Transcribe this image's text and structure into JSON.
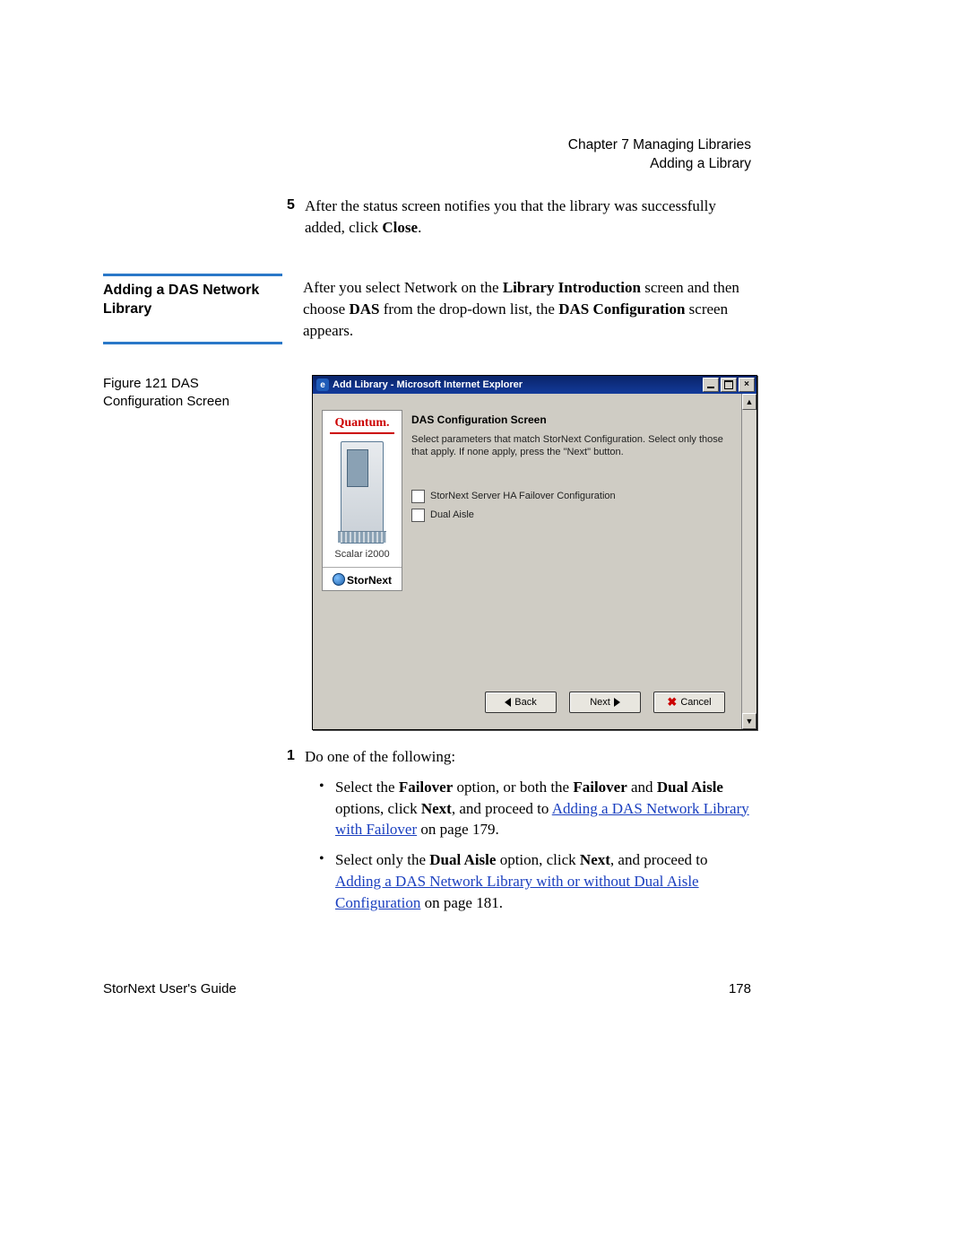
{
  "header": {
    "chapter": "Chapter 7  Managing Libraries",
    "section": "Adding a Library"
  },
  "step5": {
    "num": "5",
    "text_before": "After the status screen notifies you that the library was successfully added, click ",
    "bold": "Close",
    "text_after": "."
  },
  "sidebar": {
    "heading": "Adding a DAS Network Library"
  },
  "intro": {
    "pre": "After you select Network on the ",
    "b1": "Library Introduction",
    "mid1": " screen and then choose ",
    "b2": "DAS",
    "mid2": " from the drop-down list, the ",
    "b3": "DAS Configuration",
    "post": " screen appears."
  },
  "figure_caption": "Figure 121  DAS Configuration Screen",
  "ie": {
    "title": "Add Library - Microsoft Internet Explorer",
    "das_title": "DAS Configuration Screen",
    "das_desc": "Select parameters that match StorNext Configuration. Select only those that apply. If none apply, press the \"Next\" button.",
    "cb1": "StorNext Server HA Failover Configuration",
    "cb2": "Dual Aisle",
    "quantum": "Quantum.",
    "scalar": "Scalar i2000",
    "stornext": "StorNext",
    "back": "Back",
    "next": "Next",
    "cancel": "Cancel"
  },
  "step1": {
    "num": "1",
    "lead": "Do one of the following:",
    "bullet1": {
      "p1": "Select the ",
      "b1": "Failover",
      "p2": " option, or both the ",
      "b2": "Failover",
      "p3": " and ",
      "b3": "Dual Aisle",
      "p4": " options, click ",
      "b4": "Next",
      "p5": ", and proceed to ",
      "link": "Adding a DAS Network Library with Failover",
      "p6": " on page 179."
    },
    "bullet2": {
      "p1": "Select only the ",
      "b1": "Dual Aisle",
      "p2": " option, click ",
      "b2": "Next",
      "p3": ", and proceed to ",
      "link": "Adding a DAS Network Library with or without Dual Aisle Configuration",
      "p4": " on page 181."
    }
  },
  "footer": {
    "left": "StorNext User's Guide",
    "right": "178"
  }
}
